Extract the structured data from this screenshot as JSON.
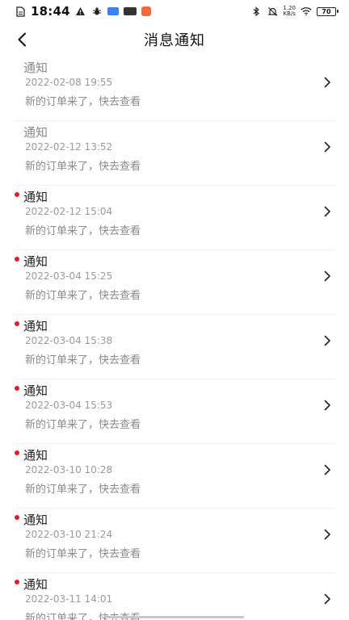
{
  "status_bar": {
    "time": "18:44",
    "net_speed_value": "1.20",
    "net_speed_unit": "KB/s",
    "battery": "70"
  },
  "header": {
    "title": "消息通知"
  },
  "messages": [
    {
      "title": "通知",
      "time": "2022-02-08 19:55",
      "content": "新的订单来了，快去查看",
      "unread": false
    },
    {
      "title": "通知",
      "time": "2022-02-12 13:52",
      "content": "新的订单来了，快去查看",
      "unread": false
    },
    {
      "title": "通知",
      "time": "2022-02-12 15:04",
      "content": "新的订单来了，快去查看",
      "unread": true
    },
    {
      "title": "通知",
      "time": "2022-03-04 15:25",
      "content": "新的订单来了，快去查看",
      "unread": true
    },
    {
      "title": "通知",
      "time": "2022-03-04 15:38",
      "content": "新的订单来了，快去查看",
      "unread": true
    },
    {
      "title": "通知",
      "time": "2022-03-04 15:53",
      "content": "新的订单来了，快去查看",
      "unread": true
    },
    {
      "title": "通知",
      "time": "2022-03-10 10:28",
      "content": "新的订单来了，快去查看",
      "unread": true
    },
    {
      "title": "通知",
      "time": "2022-03-10 21:24",
      "content": "新的订单来了，快去查看",
      "unread": true
    },
    {
      "title": "通知",
      "time": "2022-03-11 14:01",
      "content": "新的订单来了，快去查看",
      "unread": true
    }
  ],
  "colors": {
    "unread_dot": "#e02020",
    "time_text": "#9a9a9a",
    "content_text": "#8a8a8a"
  },
  "icons": {
    "back": "chevron-left-icon",
    "item_arrow": "chevron-right-icon"
  }
}
